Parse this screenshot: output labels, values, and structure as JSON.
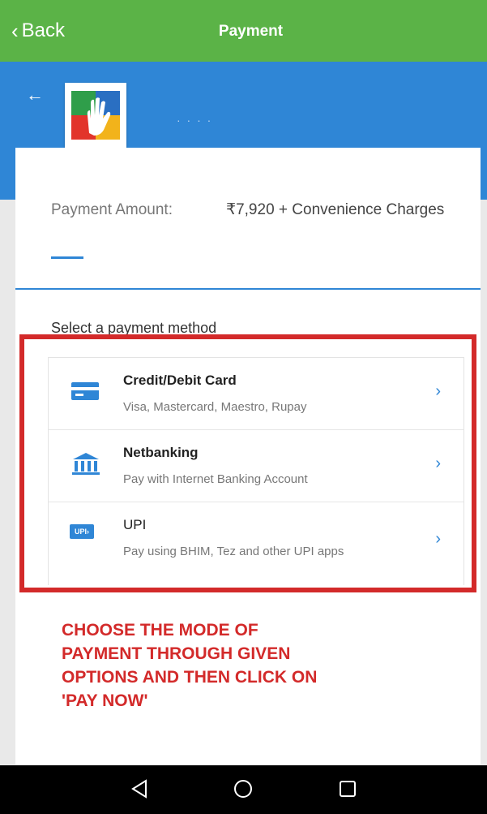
{
  "header": {
    "back_label": "Back",
    "title": "Payment"
  },
  "merchant": {
    "name": "· · · ·"
  },
  "payment": {
    "amount_label": "Payment Amount:",
    "amount_value": "₹7,920 + Convenience Charges"
  },
  "methods": {
    "title": "Select a payment method",
    "items": [
      {
        "title": "Credit/Debit Card",
        "subtitle": "Visa, Mastercard, Maestro, Rupay",
        "icon": "credit-card-icon"
      },
      {
        "title": "Netbanking",
        "subtitle": "Pay with Internet Banking Account",
        "icon": "bank-icon"
      },
      {
        "title": "UPI",
        "subtitle": "Pay using BHIM, Tez and other UPI apps",
        "icon": "upi-icon",
        "icon_text": "UPI›"
      }
    ]
  },
  "annotation": {
    "text": "CHOOSE THE MODE OF PAYMENT THROUGH GIVEN OPTIONS AND THEN CLICK ON 'PAY NOW'",
    "color": "#d32a2a"
  },
  "colors": {
    "header_green": "#5bb347",
    "accent_blue": "#2f86d6"
  }
}
